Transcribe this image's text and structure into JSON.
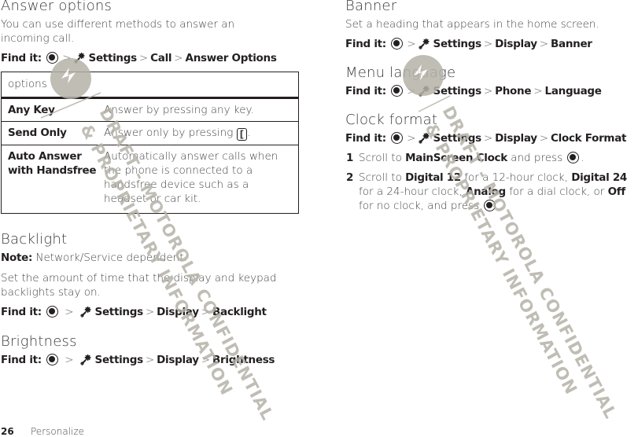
{
  "left": {
    "answer_options": {
      "title": "Answer options",
      "intro": "You can use different methods to answer an incoming call.",
      "find_label": "Find it:",
      "path": [
        "Settings",
        "Call",
        "Answer Options"
      ],
      "table": {
        "header": "options",
        "rows": [
          {
            "option": "Any Key",
            "desc": "Answer by pressing any key."
          },
          {
            "option": "Send Only",
            "desc_before": "Answer only by pressing",
            "key_glyph": "[",
            "desc_after": "."
          },
          {
            "option_line1": "Auto Answer",
            "option_line2": "with Handsfree",
            "desc": "Automatically answer calls when the phone is connected to a handsfree device such as a headset or car kit."
          }
        ]
      }
    },
    "backlight": {
      "title": "Backlight",
      "note_label": "Note:",
      "note_text": "Network/Service dependent.",
      "body": "Set the amount of time that the display and keypad backlights stay on.",
      "find_label": "Find it:",
      "path": [
        "Settings",
        "Display",
        "Backlight"
      ]
    },
    "brightness": {
      "title": "Brightness",
      "find_label": "Find it:",
      "path": [
        "Settings",
        "Display",
        "Brightness"
      ]
    }
  },
  "right": {
    "banner": {
      "title": "Banner",
      "body": "Set a heading that appears in the home screen.",
      "find_label": "Find it:",
      "path": [
        "Settings",
        "Display",
        "Banner"
      ]
    },
    "menu_language": {
      "title": "Menu language",
      "find_label": "Find it:",
      "path": [
        "Settings",
        "Phone",
        "Language"
      ]
    },
    "clock_format": {
      "title": "Clock format",
      "find_label": "Find it:",
      "path": [
        "Settings",
        "Display",
        "Clock Format"
      ],
      "steps": [
        {
          "num": "1",
          "t1": "Scroll to ",
          "b1": "MainScreen Clock",
          "t2": " and press ",
          "t3": "."
        },
        {
          "num": "2",
          "t1": "Scroll to ",
          "b1": "Digital 12",
          "t2": " for a 12-hour clock, ",
          "b2": "Digital 24",
          "t3": " for a 24-hour clock, ",
          "b3": "Analog",
          "t4": " for a dial clock, or ",
          "b4": "Off",
          "t5": " for no clock, and press ",
          "t6": "."
        }
      ]
    }
  },
  "separator": ">",
  "icons": {
    "nav_key": "nav-key-icon",
    "settings": "settings-gear-icon",
    "send_key": "send-key-icon"
  },
  "watermark": {
    "line1": "DRAFT - MOTOROLA CONFIDENTIAL",
    "line2": "& PROPRIETARY INFORMATION",
    "color": "#b5b2a8"
  },
  "footer": {
    "page_number": "26",
    "section": "Personalize"
  }
}
